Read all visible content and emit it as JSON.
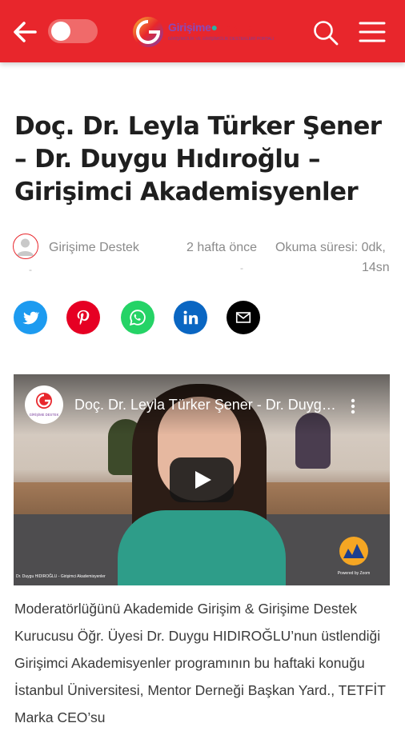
{
  "header": {
    "back_icon": "arrow-left-icon",
    "dark_mode_toggle": "off",
    "logo": {
      "name_part1": "Girişime",
      "name_part2": "Destek",
      "tagline": "GİRİŞİMCİLİK VE GİRİŞİMCİLİK DESTEKLERİ PORTALI"
    },
    "search_icon": "search-icon",
    "menu_icon": "hamburger-menu-icon",
    "background_color": "#e8262c"
  },
  "article": {
    "title": "Doç. Dr. Leyla Türker Şener – Dr. Duygu Hıdıroğlu – Girişimci Akademisyenler",
    "author": "Girişime Destek",
    "published": "2 hafta önce",
    "reading_time_line1": "Okuma süresi: 0dk,",
    "reading_time_line2": "14sn",
    "dash": "-",
    "body": "Moderatörlüğünü Akademide Girişim & Girişime Destek Kurucusu Öğr. Üyesi Dr. Duygu HIDIROĞLU’nun üstlendiği Girişimci Akademisyenler programının bu haftaki konuğu İstanbul Üniversitesi, Mentor Derneği Başkan Yard., TETFİT Marka CEO’su"
  },
  "share": {
    "items": [
      {
        "network": "twitter",
        "icon": "twitter-icon",
        "color": "#1d9bf0"
      },
      {
        "network": "pinterest",
        "icon": "pinterest-icon",
        "color": "#e60023"
      },
      {
        "network": "whatsapp",
        "icon": "whatsapp-icon",
        "color": "#25d366"
      },
      {
        "network": "linkedin",
        "icon": "linkedin-icon",
        "color": "#0a66c2"
      },
      {
        "network": "email",
        "icon": "envelope-icon",
        "color": "#000000"
      }
    ]
  },
  "video": {
    "title": "Doç. Dr. Leyla Türker Şener - Dr. Duygu Hıdıroğlu - Girişimci Akademisyenler",
    "channel_logo_text": "GİRİŞİME DESTEK",
    "caption": "Dr. Duygu HIDIROĞLU - Girişimci Akademisyenler",
    "badge_text": "Powered by Zoom",
    "play_icon": "play-icon",
    "more_icon": "vertical-dots-icon"
  }
}
